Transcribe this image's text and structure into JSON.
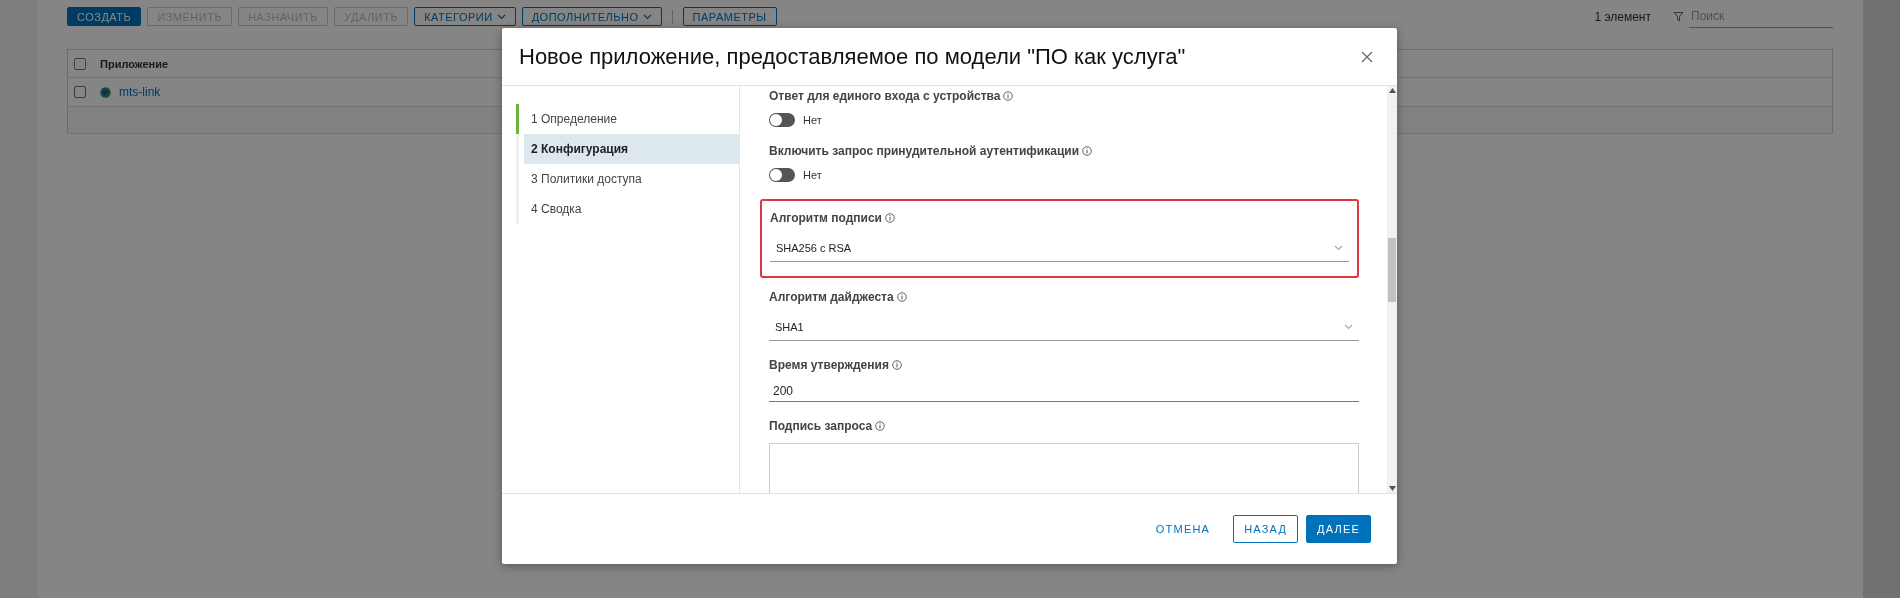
{
  "page": {
    "toolbar": [
      {
        "label": "СОЗДАТЬ",
        "kind": "primary",
        "disabled": false
      },
      {
        "label": "ИЗМЕНИТЬ",
        "kind": "plain",
        "disabled": true
      },
      {
        "label": "НАЗНАЧИТЬ",
        "kind": "plain",
        "disabled": true
      },
      {
        "label": "УДАЛИТЬ",
        "kind": "plain",
        "disabled": true
      },
      {
        "label": "КАТЕГОРИИ",
        "kind": "dropdown",
        "disabled": false
      },
      {
        "label": "ДОПОЛНИТЕЛЬНО",
        "kind": "dropdown",
        "disabled": false
      },
      {
        "label": "ПАРАМЕТРЫ",
        "kind": "plain",
        "disabled": false
      }
    ],
    "item_count": "1 элемент",
    "search": {
      "placeholder": "Поиск"
    },
    "table": {
      "select_all": {
        "checked": false
      },
      "columns": [
        "Приложение"
      ],
      "rows": [
        {
          "name": "mts-link",
          "selected": false
        }
      ]
    }
  },
  "dialog": {
    "title": "Новое приложение, предоставляемое по модели \"ПО как услуга\"",
    "steps": [
      {
        "label": "1 Определение",
        "selected": false,
        "done": true
      },
      {
        "label": "2 Конфигурация",
        "selected": true,
        "done": false
      },
      {
        "label": "3 Политики доступа",
        "selected": false,
        "done": false
      },
      {
        "label": "4 Сводка",
        "selected": false,
        "done": false
      }
    ],
    "fields": [
      {
        "kind": "toggle",
        "label": "Ответ для единого входа с устройства",
        "on": false,
        "value": "Нет",
        "highlighted": false
      },
      {
        "kind": "toggle",
        "label": "Включить запрос принудительной аутентификации",
        "on": false,
        "value": "Нет",
        "highlighted": false
      },
      {
        "kind": "select",
        "label": "Алгоритм подписи",
        "value": "SHA256 с RSA",
        "highlighted": true
      },
      {
        "kind": "select",
        "label": "Алгоритм дайджеста",
        "value": "SHA1",
        "highlighted": false
      },
      {
        "kind": "text",
        "label": "Время утверждения",
        "value": "200",
        "highlighted": false
      },
      {
        "kind": "textarea",
        "label": "Подпись запроса",
        "highlighted": false
      }
    ],
    "buttons": [
      {
        "label": "ОТМЕНА",
        "kind": "link"
      },
      {
        "label": "НАЗАД",
        "kind": "secondary"
      },
      {
        "label": "ДАЛЕЕ",
        "kind": "primary"
      }
    ]
  }
}
